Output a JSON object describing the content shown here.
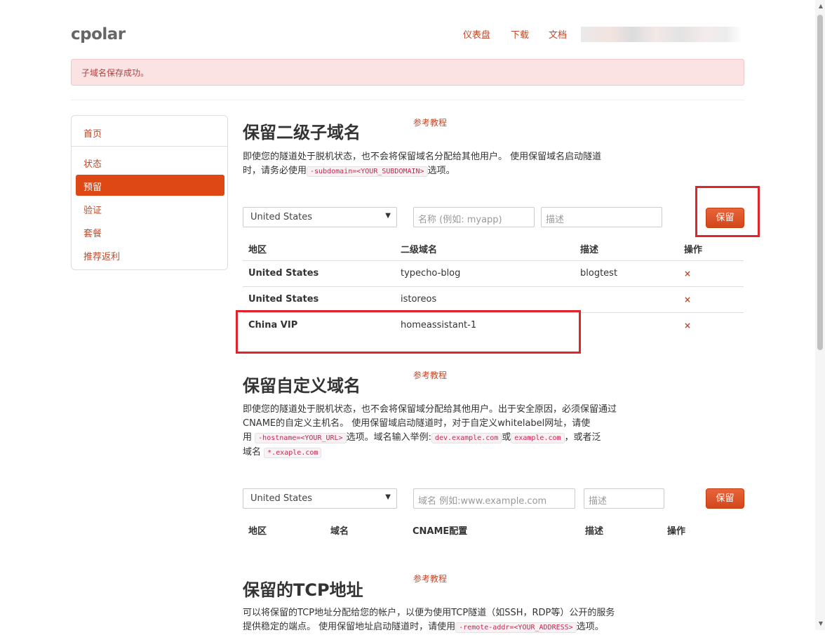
{
  "brand": "cpolar",
  "nav": [
    "仪表盘",
    "下载",
    "文档"
  ],
  "alert": "子域名保存成功。",
  "sidebar": [
    "首页",
    "状态",
    "预留",
    "验证",
    "套餐",
    "推荐返利"
  ],
  "subdomain": {
    "title": "保留二级子域名",
    "ref": "参考教程",
    "desc1": "即使您的隧道处于脱机状态，也不会将保留域名分配给其他用户。 使用保留域名启动隧道",
    "desc2_a": "时，请务必使用",
    "desc2_code": "-subdomain=<YOUR_SUBDOMAIN>",
    "desc2_b": "选项。",
    "region": "United States",
    "name_placeholder": "名称 (例如: myapp)",
    "desc_placeholder": "描述",
    "save": "保留",
    "headers": [
      "地区",
      "二级域名",
      "描述",
      "操作"
    ],
    "rows": [
      {
        "region": "United States",
        "name": "typecho-blog",
        "desc": "blogtest"
      },
      {
        "region": "United States",
        "name": "istoreos",
        "desc": ""
      },
      {
        "region": "China VIP",
        "name": "homeassistant-1",
        "desc": ""
      }
    ],
    "delete": "×"
  },
  "custom": {
    "title": "保留自定义域名",
    "ref": "参考教程",
    "line1": "即使您的隧道处于脱机状态，也不会将保留域分配给其他用户。出于安全原因，必须保留通过",
    "line2": "CNAME的自定义主机名。 使用保留域启动隧道时，对于自定义whitelabel网址，请使",
    "line3_a": "用",
    "line3_code1": "-hostname=<YOUR_URL>",
    "line3_b": "选项。域名输入举例:",
    "line3_code2": "dev.example.com",
    "line3_c": "或",
    "line3_code3": "example.com",
    "line3_d": "，或者泛",
    "line4_a": "域名",
    "line4_code": "*.exaple.com",
    "region": "United States",
    "domain_placeholder": "域名 例如:www.example.com",
    "desc_placeholder": "描述",
    "save": "保留",
    "headers": [
      "地区",
      "域名",
      "CNAME配置",
      "描述",
      "操作"
    ]
  },
  "tcp": {
    "title": "保留的TCP地址",
    "ref": "参考教程",
    "line1": "可以将保留的TCP地址分配给您的帐户，以便为使用TCP隧道（如SSH，RDP等）公开的服务",
    "line2_a": "提供稳定的端点。 使用保留地址启动隧道时，请使用",
    "line2_code": "-remote-addr=<YOUR_ADDRESS>",
    "line2_b": "选项。"
  }
}
